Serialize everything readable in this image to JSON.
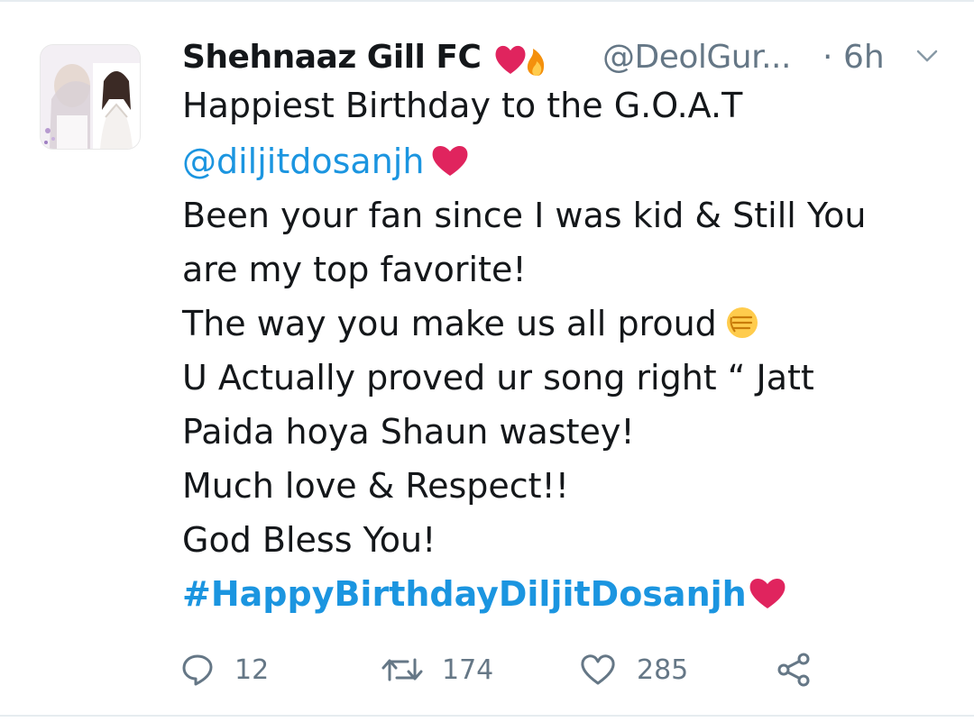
{
  "tweet": {
    "display_name": "Shehnaaz Gill FC",
    "name_emojis": [
      "heart-emoji",
      "fire-emoji"
    ],
    "handle": "@DeolGur...",
    "separator": "·",
    "time": "6h",
    "lines": [
      "Happiest Birthday to the G.O.A.T",
      "@diljitdosanjh",
      "Been your fan since I was kid & Still You",
      "are my top favorite!",
      "The way you make us all proud",
      "U Actually proved ur song right “ Jatt",
      "Paida hoya Shaun wastey!",
      "Much love & Respect!!",
      "God Bless You!",
      "#HappyBirthdayDiljitDosanjh"
    ]
  },
  "actions": {
    "reply_count": "12",
    "retweet_count": "174",
    "like_count": "285"
  },
  "colors": {
    "link_blue": "#1b95e0",
    "muted_gray": "#657786",
    "heart_red": "#e0245e",
    "text": "#14171a"
  },
  "icons": [
    "reply-icon",
    "retweet-icon",
    "like-icon",
    "share-icon",
    "chevron-down-icon"
  ]
}
